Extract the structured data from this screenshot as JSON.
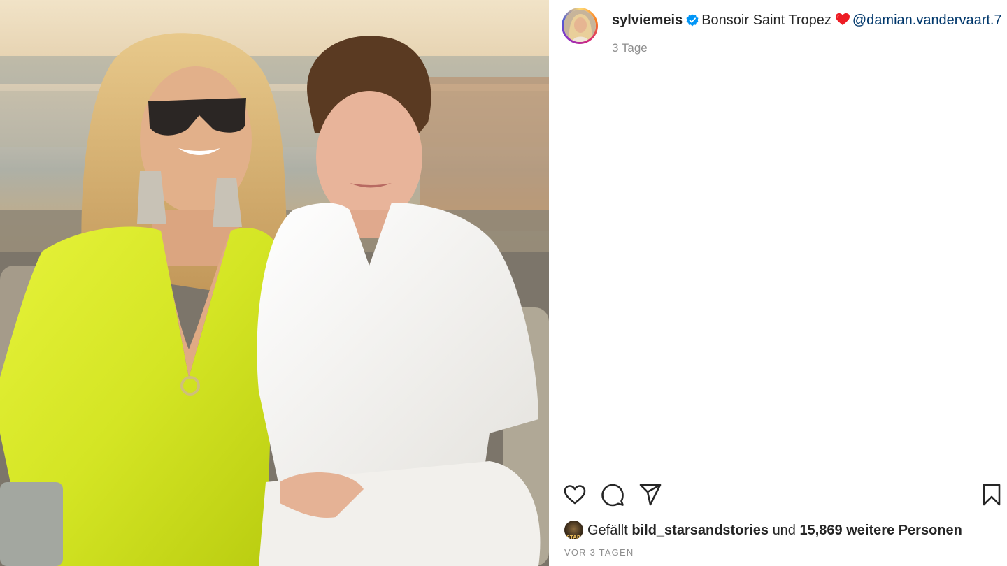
{
  "post": {
    "image_alt": "Bonsoir Saint Tropez",
    "author": {
      "username": "sylviemeis",
      "verified": true,
      "avatar_icon": "profile-photo"
    },
    "caption": {
      "text": "Bonsoir Saint Tropez",
      "emoji": "heart-emoji",
      "mention": "@damian.vandervaart.7"
    },
    "time_ago": "3 Tage",
    "actions": {
      "like_icon": "heart-icon",
      "comment_icon": "comment-icon",
      "share_icon": "send-icon",
      "save_icon": "bookmark-icon"
    },
    "likes": {
      "prefix": "Gefällt",
      "liker_avatar_text": "STARS",
      "liker": "bild_starsandstories",
      "joiner": "und",
      "others": "15,869 weitere Personen"
    },
    "date": "VOR 3 TAGEN"
  },
  "colors": {
    "text": "#262626",
    "secondary": "#8e8e8e",
    "mention": "#00376b",
    "verified_badge": "#0095f6",
    "heart_emoji": "#ed1c24"
  }
}
